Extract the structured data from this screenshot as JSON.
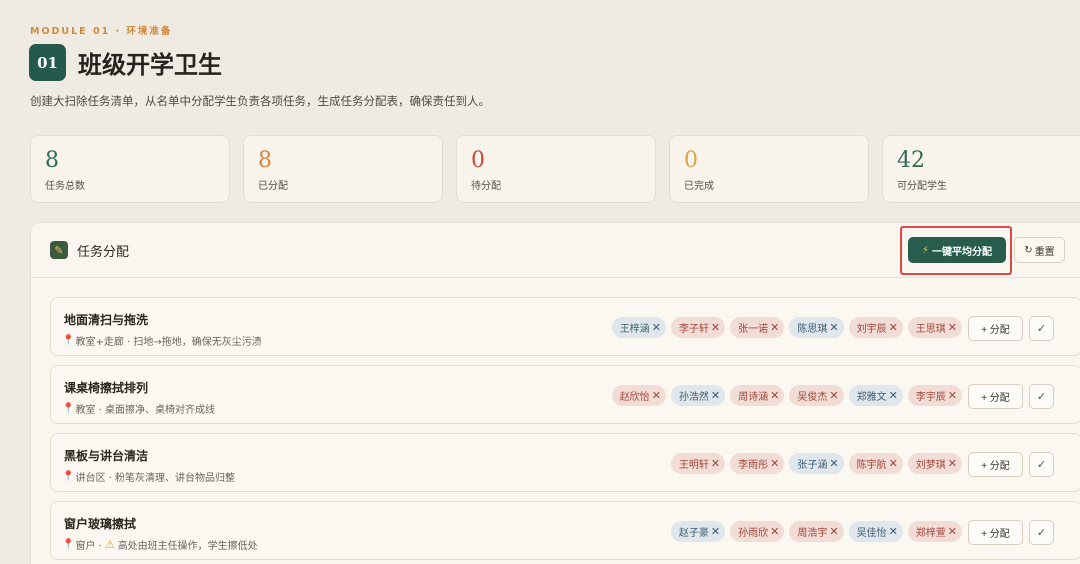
{
  "header": {
    "module_label": "MODULE 01 · 环境准备",
    "number": "01",
    "title": "班级开学卫生",
    "subtitle": "创建大扫除任务清单，从名单中分配学生负责各项任务，生成任务分配表，确保责任到人。"
  },
  "stats": [
    {
      "value": "8",
      "label": "任务总数",
      "color": "#2f6b55"
    },
    {
      "value": "8",
      "label": "已分配",
      "color": "#d9823a"
    },
    {
      "value": "0",
      "label": "待分配",
      "color": "#c9473d"
    },
    {
      "value": "0",
      "label": "已完成",
      "color": "#d9a54a"
    },
    {
      "value": "42",
      "label": "可分配学生",
      "color": "#2f6b55"
    }
  ],
  "panel": {
    "title": "任务分配",
    "auto_assign_label": "一键平均分配",
    "reset_label": "重置"
  },
  "tasks": [
    {
      "name": "地面清扫与拖洗",
      "meta": "教室+走廊 · 扫地→拖地，确保无灰尘污渍",
      "warning": "",
      "students": [
        {
          "name": "王梓涵",
          "tone": "blue"
        },
        {
          "name": "李子轩",
          "tone": "red"
        },
        {
          "name": "张一诺",
          "tone": "red"
        },
        {
          "name": "陈思琪",
          "tone": "blue"
        },
        {
          "name": "刘宇辰",
          "tone": "red"
        },
        {
          "name": "王思琪",
          "tone": "red"
        }
      ]
    },
    {
      "name": "课桌椅擦拭排列",
      "meta": "教室 · 桌面擦净、桌椅对齐成线",
      "warning": "",
      "students": [
        {
          "name": "赵欣怡",
          "tone": "red"
        },
        {
          "name": "孙浩然",
          "tone": "blue"
        },
        {
          "name": "周诗涵",
          "tone": "red"
        },
        {
          "name": "吴俊杰",
          "tone": "red"
        },
        {
          "name": "郑雅文",
          "tone": "blue"
        },
        {
          "name": "李宇辰",
          "tone": "red"
        }
      ]
    },
    {
      "name": "黑板与讲台清洁",
      "meta": "讲台区 · 粉笔灰清理、讲台物品归整",
      "warning": "",
      "students": [
        {
          "name": "王明轩",
          "tone": "red"
        },
        {
          "name": "李雨彤",
          "tone": "red"
        },
        {
          "name": "张子涵",
          "tone": "blue"
        },
        {
          "name": "陈宇航",
          "tone": "red"
        },
        {
          "name": "刘梦琪",
          "tone": "red"
        }
      ]
    },
    {
      "name": "窗户玻璃擦拭",
      "meta": "窗户 · ",
      "warning": "高处由班主任操作，学生擦低处",
      "students": [
        {
          "name": "赵子豪",
          "tone": "blue"
        },
        {
          "name": "孙雨欣",
          "tone": "red"
        },
        {
          "name": "周浩宇",
          "tone": "red"
        },
        {
          "name": "吴佳怡",
          "tone": "blue"
        },
        {
          "name": "郑梓萱",
          "tone": "red"
        }
      ]
    }
  ],
  "assign_label": "+ 分配",
  "check_label": "✓",
  "remove_glyph": "✕"
}
